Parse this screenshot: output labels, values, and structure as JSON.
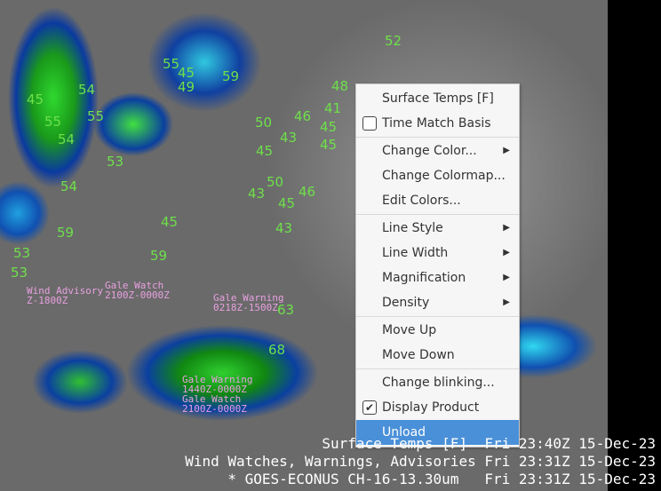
{
  "map": {
    "temps": [
      "52",
      "48",
      "45",
      "54",
      "55",
      "55",
      "46",
      "41",
      "45",
      "50",
      "43",
      "45",
      "54",
      "53",
      "45",
      "54",
      "50",
      "46",
      "43",
      "45",
      "45",
      "43",
      "59",
      "59",
      "53",
      "53",
      "63",
      "68",
      "55",
      "45",
      "49",
      "59"
    ],
    "warnings": [
      "Gale Watch\n2100Z-0000Z",
      "Gale Warning\n0218Z-1500Z",
      "Gale Warning\n1440Z-0000Z\nGale Watch\n2100Z-0000Z",
      "Wind Advisory\nZ-1800Z"
    ]
  },
  "legend": [
    "Surface Temps [F]  Fri 23:40Z 15-Dec-23",
    "Wind Watches, Warnings, Advisories Fri 23:31Z 15-Dec-23",
    "* GOES-ECONUS CH-16-13.30um   Fri 23:31Z 15-Dec-23"
  ],
  "menu": {
    "items": [
      {
        "label": "Surface Temps [F]"
      },
      {
        "label": "Time Match Basis",
        "checkbox": true,
        "checked": false
      },
      {
        "sep": true
      },
      {
        "label": "Change Color...",
        "submenu": true
      },
      {
        "label": "Change Colormap..."
      },
      {
        "label": "Edit Colors..."
      },
      {
        "sep": true
      },
      {
        "label": "Line Style",
        "submenu": true
      },
      {
        "label": "Line Width",
        "submenu": true
      },
      {
        "label": "Magnification",
        "submenu": true
      },
      {
        "label": "Density",
        "submenu": true
      },
      {
        "sep": true
      },
      {
        "label": "Move Up"
      },
      {
        "label": "Move Down"
      },
      {
        "sep": true
      },
      {
        "label": "Change blinking..."
      },
      {
        "label": "Display Product",
        "checkbox": true,
        "checked": true
      },
      {
        "label": "Unload",
        "highlighted": true
      }
    ],
    "highlight_color": "#4a90d9"
  }
}
